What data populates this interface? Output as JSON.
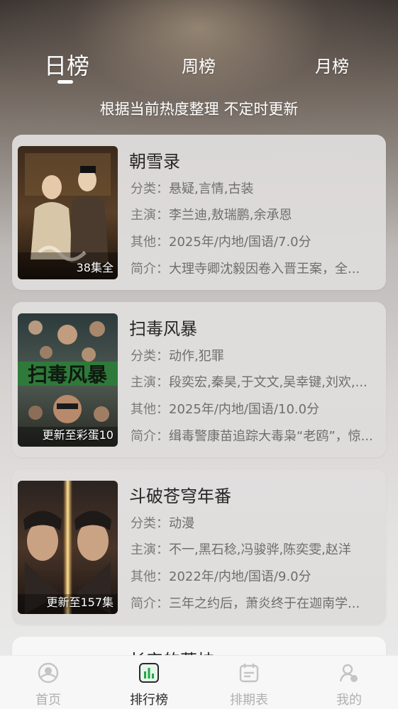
{
  "tabs": {
    "daily": "日榜",
    "weekly": "周榜",
    "monthly": "月榜",
    "active": "daily"
  },
  "subtitle": "根据当前热度整理 不定时更新",
  "labels": {
    "category": "分类：",
    "cast": "主演：",
    "other": "其他：",
    "synopsis": "简介："
  },
  "items": [
    {
      "title": "朝雪录",
      "badge": "38集全",
      "category": "悬疑,言情,古装",
      "cast": "李兰迪,敖瑞鹏,余承恩",
      "other": "2025年/内地/国语/7.0分",
      "synopsis": "大理寺卿沈毅因卷入晋王案，全..."
    },
    {
      "title": "扫毒风暴",
      "badge": "更新至彩蛋10",
      "category": "动作,犯罪",
      "cast": "段奕宏,秦昊,于文文,吴幸键,刘欢,...",
      "other": "2025年/内地/国语/10.0分",
      "synopsis": "缉毒警康苗追踪大毒枭“老鸥”，惊..."
    },
    {
      "title": "斗破苍穹年番",
      "badge": "更新至157集",
      "category": "动漫",
      "cast": "不一,黑石稔,冯骏骅,陈奕雯,赵洋",
      "other": "2022年/内地/国语/9.0分",
      "synopsis": "三年之约后，萧炎终于在迦南学..."
    }
  ],
  "partial_item": {
    "title": "长安的荔枝"
  },
  "nav": {
    "home": "首页",
    "ranking": "排行榜",
    "schedule": "排期表",
    "mine": "我的",
    "active": "ranking"
  },
  "colors": {
    "accent_green": "#21a64a",
    "inactive_gray": "#b0b0b0",
    "active_text": "#2a2a2a"
  }
}
